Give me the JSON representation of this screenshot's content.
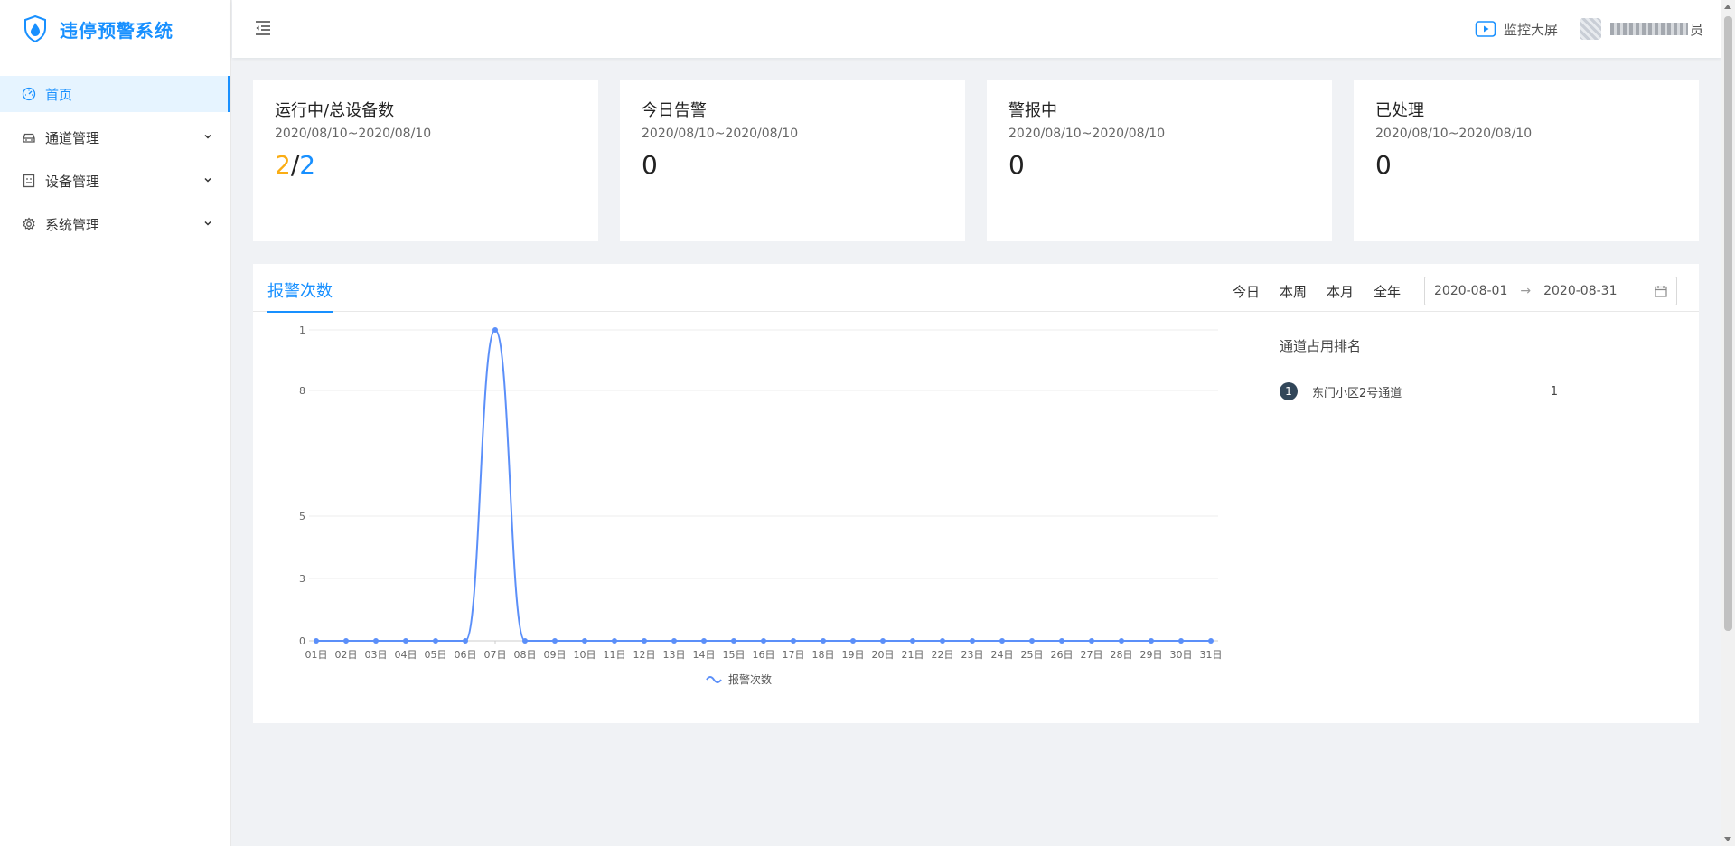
{
  "app": {
    "title": "违停预警系统"
  },
  "sidebar": {
    "items": [
      {
        "label": "首页",
        "icon": "dashboard-icon"
      },
      {
        "label": "通道管理",
        "icon": "car-icon"
      },
      {
        "label": "设备管理",
        "icon": "device-icon"
      },
      {
        "label": "系统管理",
        "icon": "gear-icon"
      }
    ]
  },
  "header": {
    "monitor_label": "监控大屏",
    "user_suffix": "员"
  },
  "cards": [
    {
      "title": "运行中/总设备数",
      "date": "2020/08/10~2020/08/10",
      "running": "2",
      "sep": "/",
      "total": "2"
    },
    {
      "title": "今日告警",
      "date": "2020/08/10~2020/08/10",
      "value": "0"
    },
    {
      "title": "警报中",
      "date": "2020/08/10~2020/08/10",
      "value": "0"
    },
    {
      "title": "已处理",
      "date": "2020/08/10~2020/08/10",
      "value": "0"
    }
  ],
  "panel": {
    "tab": "报警次数",
    "ranges": [
      "今日",
      "本周",
      "本月",
      "全年"
    ],
    "date_start": "2020-08-01",
    "date_sep": "→",
    "date_end": "2020-08-31"
  },
  "ranking": {
    "title": "通道占用排名",
    "items": [
      {
        "rank": "1",
        "name": "东门小区2号通道",
        "value": "1"
      }
    ]
  },
  "colors": {
    "accent": "#1890ff",
    "orange": "#faad14",
    "line": "#5b8ff9"
  },
  "chart_data": {
    "type": "line",
    "x": [
      "01日",
      "02日",
      "03日",
      "04日",
      "05日",
      "06日",
      "07日",
      "08日",
      "09日",
      "10日",
      "11日",
      "12日",
      "13日",
      "14日",
      "15日",
      "16日",
      "17日",
      "18日",
      "19日",
      "20日",
      "21日",
      "22日",
      "23日",
      "24日",
      "25日",
      "26日",
      "27日",
      "28日",
      "29日",
      "30日",
      "31日"
    ],
    "series": [
      {
        "name": "报警次数",
        "values": [
          0,
          0,
          0,
          0,
          0,
          0,
          1,
          0,
          0,
          0,
          0,
          0,
          0,
          0,
          0,
          0,
          0,
          0,
          0,
          0,
          0,
          0,
          0,
          0,
          0,
          0,
          0,
          0,
          0,
          0,
          0
        ]
      }
    ],
    "y_ticks": [
      "0",
      "3",
      "5",
      "8",
      "1"
    ],
    "ylim": [
      0,
      1
    ],
    "grid": true,
    "legend": "bottom-center",
    "smooth": true
  }
}
